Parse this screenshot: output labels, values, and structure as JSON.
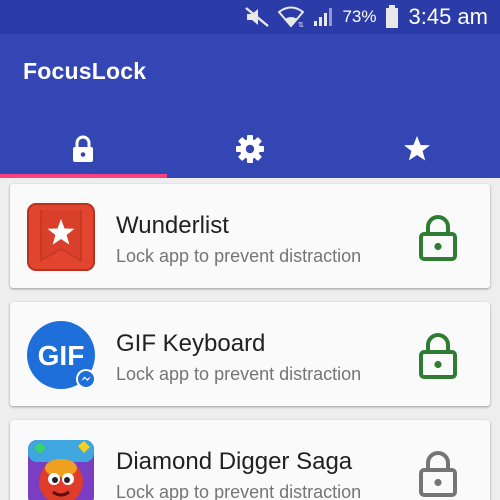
{
  "status_bar": {
    "battery_percent": "73%",
    "time": "3:45 am",
    "icons": [
      "mute-icon",
      "wifi-icon",
      "signal-icon",
      "battery-icon"
    ]
  },
  "app": {
    "title": "FocusLock",
    "bar_color": "#3445b4",
    "accent_color": "#ff4081"
  },
  "tabs": [
    {
      "icon": "lock-icon",
      "selected": true
    },
    {
      "icon": "gear-icon",
      "selected": false
    },
    {
      "icon": "star-icon",
      "selected": false
    }
  ],
  "apps": [
    {
      "name": "Wunderlist",
      "subtitle": "Lock app to prevent distraction",
      "locked": true,
      "icon": "wunderlist-icon"
    },
    {
      "name": "GIF Keyboard",
      "subtitle": "Lock app to prevent distraction",
      "locked": true,
      "icon": "gif-keyboard-icon",
      "icon_text": "GIF"
    },
    {
      "name": "Diamond Digger Saga",
      "subtitle": "Lock app to prevent distraction",
      "locked": false,
      "icon": "diamond-digger-icon"
    }
  ],
  "colors": {
    "locked": "#2e7d32",
    "unlocked": "#757575"
  }
}
